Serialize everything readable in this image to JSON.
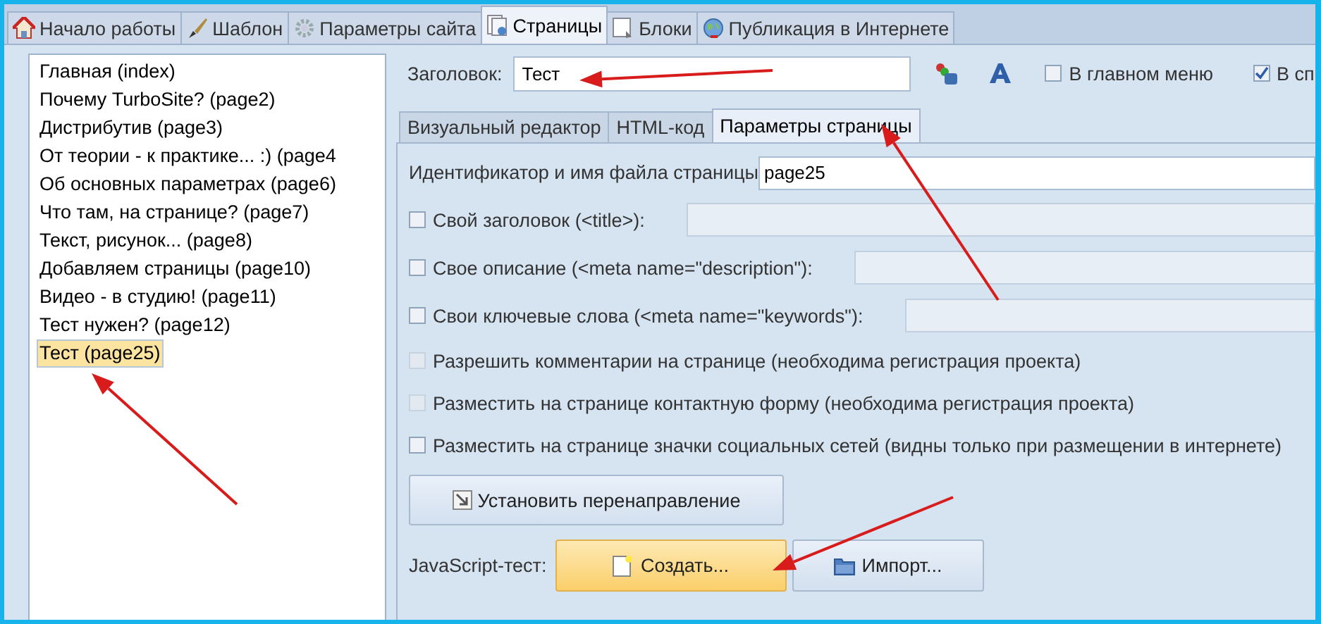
{
  "tabs": [
    {
      "label": "Начало работы",
      "selected": false
    },
    {
      "label": "Шаблон",
      "selected": false
    },
    {
      "label": "Параметры сайта",
      "selected": false
    },
    {
      "label": "Страницы",
      "selected": true
    },
    {
      "label": "Блоки",
      "selected": false
    },
    {
      "label": "Публикация в Интернете",
      "selected": false
    }
  ],
  "page_list": {
    "items": [
      {
        "label": "Главная (index)",
        "selected": false
      },
      {
        "label": "Почему TurboSite? (page2)",
        "selected": false
      },
      {
        "label": "Дистрибутив (page3)",
        "selected": false
      },
      {
        "label": "От теории - к практике... :) (page4",
        "selected": false
      },
      {
        "label": "Об основных параметрах (page6)",
        "selected": false
      },
      {
        "label": "Что там, на странице? (page7)",
        "selected": false
      },
      {
        "label": "Текст, рисунок... (page8)",
        "selected": false
      },
      {
        "label": "Добавляем страницы (page10)",
        "selected": false
      },
      {
        "label": "Видео - в студию! (page11)",
        "selected": false
      },
      {
        "label": "Тест нужен? (page12)",
        "selected": false
      },
      {
        "label": "Тест (page25)",
        "selected": true
      }
    ]
  },
  "title_field": {
    "label": "Заголовок:",
    "value": "Тест"
  },
  "menu_options": [
    {
      "label": "В главном меню",
      "checked": false
    },
    {
      "label": "В сп",
      "checked": true
    }
  ],
  "editor_tabs": [
    {
      "label": "Визуальный редактор",
      "selected": false
    },
    {
      "label": "HTML-код",
      "selected": false
    },
    {
      "label": "Параметры страницы",
      "selected": true
    }
  ],
  "page_id": {
    "label": "Идентификатор и имя файла страницы",
    "value": "page25"
  },
  "options": [
    {
      "kind": "field",
      "label": "Свой заголовок (<title>):",
      "checked": false,
      "disabled": false
    },
    {
      "kind": "field",
      "label": "Свое описание (<meta name=\"description\"):",
      "checked": false,
      "disabled": false
    },
    {
      "kind": "field",
      "label": "Свои ключевые слова (<meta name=\"keywords\"):",
      "checked": false,
      "disabled": false
    },
    {
      "kind": "plain",
      "label": "Разрешить комментарии на странице (необходима регистрация проекта)",
      "checked": false,
      "disabled": true
    },
    {
      "kind": "plain",
      "label": "Разместить на странице контактную форму (необходима регистрация проекта)",
      "checked": false,
      "disabled": true
    },
    {
      "kind": "plain",
      "label": "Разместить на странице значки социальных сетей (видны только при размещении в интернете)",
      "checked": false,
      "disabled": false
    }
  ],
  "redirect_button": "Установить перенаправление",
  "javascript": {
    "label": "JavaScript-тест:",
    "buttons": [
      {
        "label": "Создать...",
        "highlighted": true
      },
      {
        "label": "Импорт...",
        "highlighted": false
      }
    ]
  }
}
